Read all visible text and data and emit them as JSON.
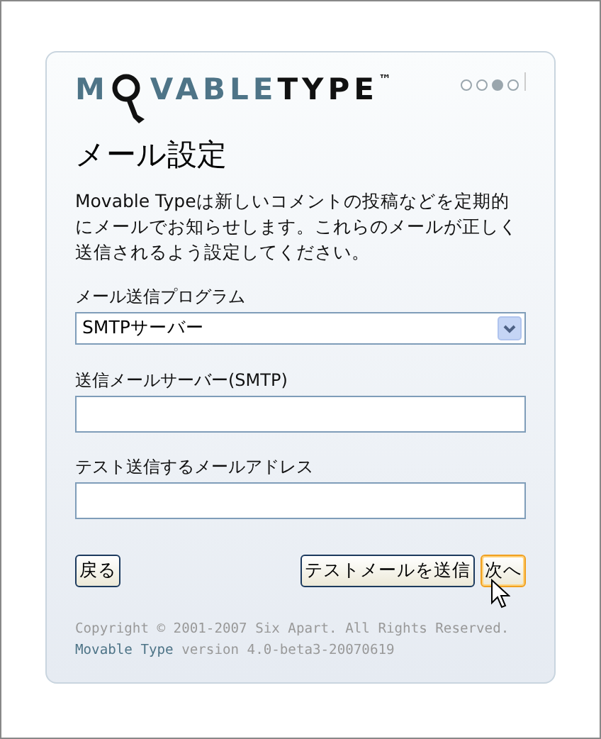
{
  "logo": {
    "first": "M",
    "light": "VABLE",
    "dark": "TYPE",
    "mark": "™"
  },
  "progress": [
    {
      "selected": false
    },
    {
      "selected": false
    },
    {
      "selected": true
    },
    {
      "selected": false
    }
  ],
  "title": "メール設定",
  "intro": "Movable Typeは新しいコメントの投稿などを定期的にメールでお知らせします。これらのメールが正しく送信されるよう設定してください。",
  "fields": [
    {
      "kind": "select",
      "label": "メール送信プログラム",
      "value": "SMTPサーバー"
    },
    {
      "kind": "text",
      "label": "送信メールサーバー(SMTP)"
    },
    {
      "kind": "text",
      "label": "テスト送信するメールアドレス"
    }
  ],
  "buttons": [
    {
      "label": "戻る",
      "highlighted": false,
      "kind": "back"
    },
    {
      "label": "テストメールを送信",
      "highlighted": false,
      "kind": "action"
    },
    {
      "label": "次へ",
      "highlighted": true,
      "kind": "action"
    }
  ],
  "footer": {
    "copyright": "Copyright © 2001-2007 Six Apart. All Rights Reserved.",
    "link": "Movable Type",
    "version": "version 4.0-beta3-20070619"
  }
}
